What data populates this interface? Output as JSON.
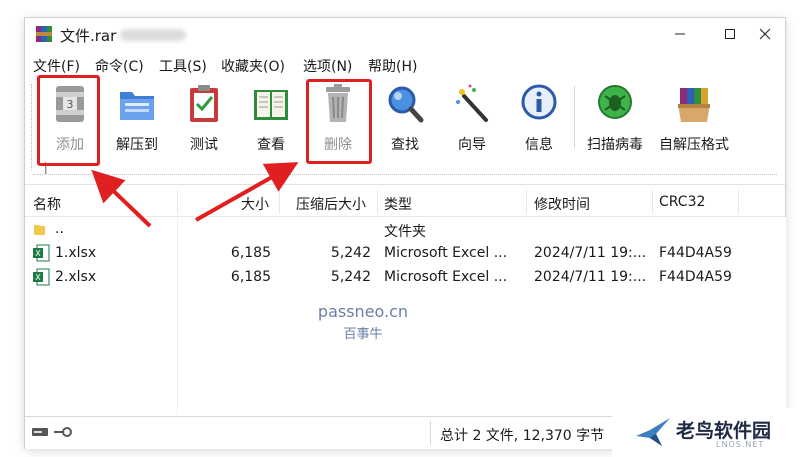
{
  "window": {
    "title": "文件.rar",
    "controls": [
      "minimize-icon",
      "maximize-icon",
      "close-icon"
    ]
  },
  "menu": [
    "文件(F)",
    "命令(C)",
    "工具(S)",
    "收藏夹(O)",
    "选项(N)",
    "帮助(H)"
  ],
  "toolbar": {
    "buttons": [
      {
        "label": "添加",
        "icon": "archive-add-icon",
        "disabled": true
      },
      {
        "label": "解压到",
        "icon": "extract-folder-icon",
        "disabled": false
      },
      {
        "label": "测试",
        "icon": "test-clipboard-icon",
        "disabled": false
      },
      {
        "label": "查看",
        "icon": "view-book-icon",
        "disabled": false
      },
      {
        "label": "删除",
        "icon": "trash-icon",
        "disabled": true
      },
      {
        "label": "查找",
        "icon": "find-magnifier-icon",
        "disabled": false
      },
      {
        "label": "向导",
        "icon": "wizard-wand-icon",
        "disabled": false
      },
      {
        "label": "信息",
        "icon": "info-icon",
        "disabled": false
      },
      {
        "label": "扫描病毒",
        "icon": "virus-scan-icon",
        "disabled": false
      },
      {
        "label": "自解压格式",
        "icon": "sfx-archive-icon",
        "disabled": false
      }
    ],
    "up_glyph": "↑"
  },
  "list": {
    "columns": [
      "名称",
      "大小",
      "压缩后大小",
      "类型",
      "修改时间",
      "CRC32"
    ],
    "rows": [
      {
        "name": "..",
        "size": "",
        "packed": "",
        "type": "文件夹",
        "modified": "",
        "crc": "",
        "icon": "folder-icon"
      },
      {
        "name": "1.xlsx",
        "size": "6,185",
        "packed": "5,242",
        "type": "Microsoft Excel ...",
        "modified": "2024/7/11 19:...",
        "crc": "F44D4A59",
        "icon": "excel-file-icon"
      },
      {
        "name": "2.xlsx",
        "size": "6,185",
        "packed": "5,242",
        "type": "Microsoft Excel ...",
        "modified": "2024/7/11 19:...",
        "crc": "F44D4A59",
        "icon": "excel-file-icon"
      }
    ]
  },
  "watermark": {
    "line1": "passneo.cn",
    "line2": "百事牛"
  },
  "status": {
    "text": "总计 2 文件, 12,370 字节"
  },
  "branding": {
    "name": "老鸟软件园",
    "sub": "LNOS.NET"
  },
  "colors": {
    "highlight": "#e02020",
    "excel": "#1e7a45",
    "folder": "#f2c94c"
  }
}
